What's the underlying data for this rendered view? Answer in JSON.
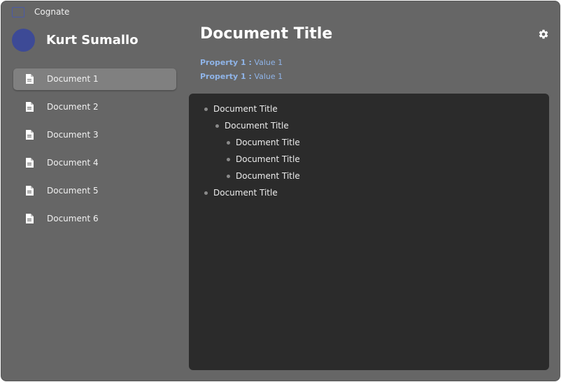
{
  "app": {
    "title": "Cognate",
    "icon": "window-icon"
  },
  "user": {
    "name": "Kurt Sumallo",
    "avatar_color": "#3d4a96"
  },
  "sidebar": {
    "items": [
      {
        "label": "Document 1",
        "icon": "document-icon",
        "active": true
      },
      {
        "label": "Document 2",
        "icon": "document-icon",
        "active": false
      },
      {
        "label": "Document 3",
        "icon": "document-icon",
        "active": false
      },
      {
        "label": "Document 4",
        "icon": "document-icon",
        "active": false
      },
      {
        "label": "Document 5",
        "icon": "document-icon",
        "active": false
      },
      {
        "label": "Document 6",
        "icon": "document-icon",
        "active": false
      }
    ]
  },
  "document": {
    "title": "Document Title",
    "settings_icon": "gear-icon",
    "properties": [
      {
        "key": "Property 1 :",
        "value": "Value 1"
      },
      {
        "key": "Property 1 :",
        "value": "Value 1"
      }
    ],
    "outline": [
      {
        "text": "Document Title",
        "level": 0
      },
      {
        "text": "Document Title",
        "level": 1
      },
      {
        "text": "Document Title",
        "level": 2
      },
      {
        "text": "Document Title",
        "level": 2
      },
      {
        "text": "Document Title",
        "level": 2
      },
      {
        "text": "Document Title",
        "level": 0
      }
    ]
  },
  "colors": {
    "window_bg": "#666666",
    "editor_bg": "#2b2b2b",
    "active_item_bg": "#808080",
    "property_color": "#8fb4e8",
    "accent": "#3d4a96"
  }
}
